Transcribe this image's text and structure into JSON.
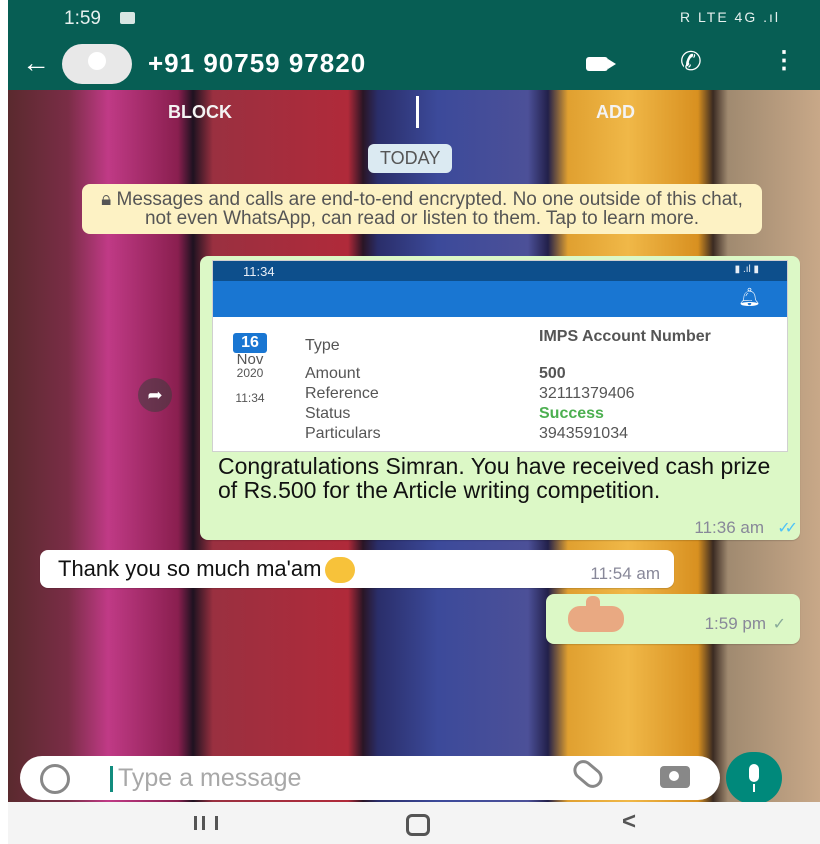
{
  "status_bar": {
    "time": "1:59",
    "right_indicators": "R LTE 4G .ıl"
  },
  "header": {
    "contact": "+91 90759 97820"
  },
  "actions": {
    "block": "BLOCK",
    "add": "ADD"
  },
  "date_chip": "TODAY",
  "encryption_notice": "Messages and calls are end-to-end encrypted. No one outside of this chat, not even WhatsApp, can read or listen to them. Tap to learn more.",
  "messages": [
    {
      "attachment": {
        "status_time": "11:34",
        "date_day": "16",
        "date_month": "Nov",
        "date_year": "2020",
        "date_time": "11:34",
        "rows": [
          {
            "label": "Type",
            "value": "IMPS Account Number"
          },
          {
            "label": "Amount",
            "value": "500"
          },
          {
            "label": "Reference",
            "value": "32111379406"
          },
          {
            "label": "Status",
            "value": "Success"
          },
          {
            "label": "Particulars",
            "value": "3943591034"
          }
        ]
      },
      "text": "Congratulations Simran. You have received cash prize of Rs.500 for the Article writing competition.",
      "time": "11:36 am"
    },
    {
      "text": "Thank you so much ma'am",
      "time": "11:54 am"
    },
    {
      "time": "1:59 pm"
    }
  ],
  "composer": {
    "placeholder": "Type a message"
  },
  "icons": {
    "back": "arrow-left",
    "video": "video-camera",
    "call": "phone",
    "menu": "more-vertical",
    "emoji": "smiley",
    "attach": "paperclip",
    "camera": "camera",
    "mic": "microphone"
  },
  "colors": {
    "app_bar": "#075e54",
    "outgoing_bubble": "#dcf8c6",
    "incoming_bubble": "#ffffff",
    "read_ticks": "#4fc3f7",
    "mic_button": "#00897b",
    "encryption_banner": "#fdf2c4",
    "bank_status_bar": "#0d4f8c",
    "bank_app_bar": "#1976d2",
    "success": "#4caf50"
  }
}
